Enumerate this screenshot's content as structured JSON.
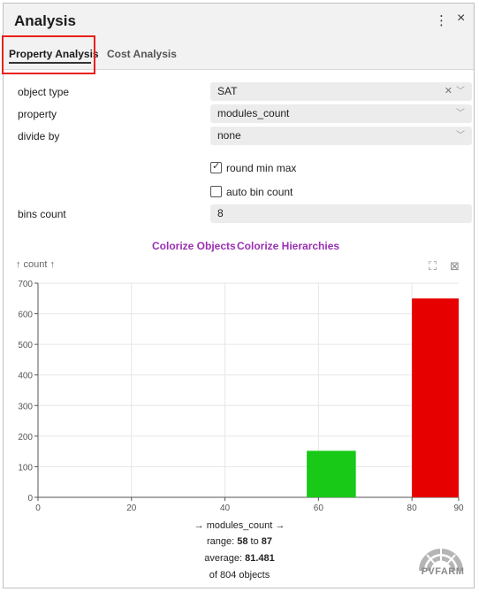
{
  "header": {
    "title": "Analysis",
    "menu_icon": "more-vertical-icon",
    "close_icon": "close-icon",
    "menu_glyph": "⋮",
    "close_glyph": "×"
  },
  "tabs": [
    {
      "label": "Property Analysis",
      "active": true
    },
    {
      "label": "Cost Analysis",
      "active": false
    }
  ],
  "form": {
    "object_type": {
      "label": "object type",
      "value": "SAT"
    },
    "property": {
      "label": "property",
      "value": "modules_count"
    },
    "divide_by": {
      "label": "divide by",
      "value": "none"
    },
    "round_min_max": {
      "label": "round min max",
      "checked": true
    },
    "auto_bin_count": {
      "label": "auto bin count",
      "checked": false
    },
    "bins_count": {
      "label": "bins count",
      "value": "8"
    }
  },
  "actions": {
    "colorize_objects": "Colorize Objects",
    "colorize_hierarchies": "Colorize Hierarchies"
  },
  "chart_data": {
    "type": "bar",
    "ylabel": "↑ count ↑",
    "xlabel": "→ modules_count →",
    "xlim": [
      0,
      90
    ],
    "ylim": [
      0,
      700
    ],
    "x_ticks": [
      0,
      20,
      40,
      60,
      80,
      90
    ],
    "y_ticks": [
      0,
      100,
      200,
      300,
      400,
      500,
      600,
      700
    ],
    "bars": [
      {
        "x_start": 57.5,
        "x_end": 68,
        "value": 152,
        "color": "#18c918"
      },
      {
        "x_start": 80,
        "x_end": 90,
        "value": 650,
        "color": "#e60000"
      }
    ],
    "grid": true
  },
  "summary": {
    "range_prefix": "range: ",
    "range_min": "58",
    "range_to": " to ",
    "range_max": "87",
    "average_prefix": "average: ",
    "average_value": "81.481",
    "objects_text": "of 804 objects"
  },
  "logo": {
    "text": "PVFARM"
  },
  "colors": {
    "accent": "#9b2fb5",
    "highlight": "#e8201b"
  }
}
